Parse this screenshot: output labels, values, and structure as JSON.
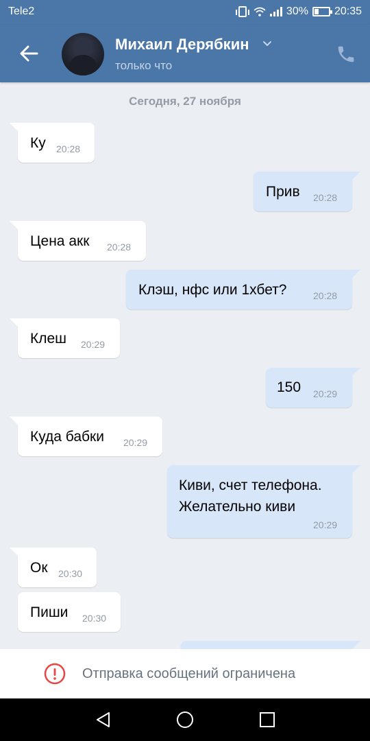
{
  "status_bar": {
    "carrier": "Tele2",
    "battery": "30%",
    "battery_level": 0.3,
    "time": "20:35"
  },
  "header": {
    "contact_name": "Михаил Дерябкин",
    "contact_status": "только что"
  },
  "chat": {
    "date_separator": "Сегодня, 27 ноября",
    "messages": [
      {
        "dir": "in",
        "text": "Ку",
        "time": "20:28"
      },
      {
        "dir": "out",
        "text": "Прив",
        "time": "20:28"
      },
      {
        "dir": "in",
        "text": "Цена акк",
        "time": "20:28"
      },
      {
        "dir": "out",
        "text": "Клэш, нфс или 1хбет?",
        "time": "20:28"
      },
      {
        "dir": "in",
        "text": "Клеш",
        "time": "20:29"
      },
      {
        "dir": "out",
        "text": "150",
        "time": "20:29"
      },
      {
        "dir": "in",
        "text": "Куда бабки",
        "time": "20:29"
      },
      {
        "dir": "out",
        "text": "Киви, счет телефона.",
        "text2": "Желательно киви",
        "time": "20:29"
      },
      {
        "dir": "in",
        "text": "Ок",
        "time": "20:30"
      },
      {
        "dir": "in",
        "text": "Пиши",
        "time": "20:30"
      }
    ]
  },
  "footer": {
    "restricted_text": "Отправка сообщений ограничена"
  },
  "icons": {
    "back": "arrow-left-icon",
    "call": "phone-icon",
    "chevron": "chevron-down-icon",
    "warning": "alert-circle-icon"
  },
  "colors": {
    "header": "#4a76a8",
    "background": "#ebeef2",
    "incoming_bubble": "#ffffff",
    "outgoing_bubble": "#d7e6f9",
    "warning": "#e64646"
  }
}
